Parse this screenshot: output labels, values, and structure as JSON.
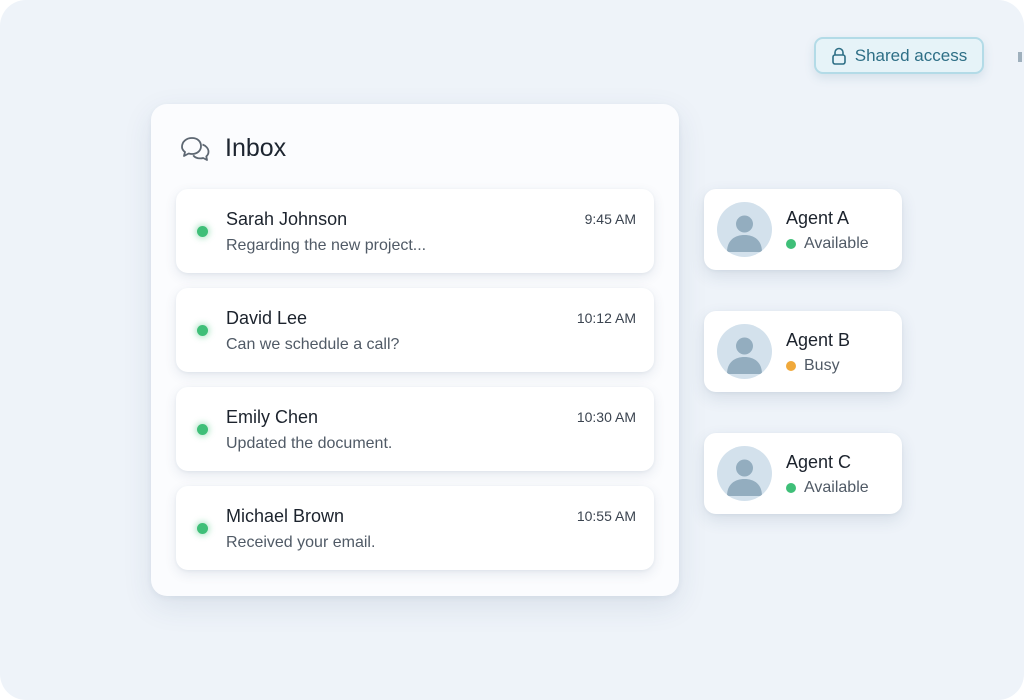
{
  "shared_access": {
    "label": "Shared access",
    "icon": "lock-icon"
  },
  "inbox": {
    "title": "Inbox",
    "icon": "chat-bubbles-icon",
    "messages": [
      {
        "sender": "Sarah Johnson",
        "preview": "Regarding the new project...",
        "time": "9:45 AM"
      },
      {
        "sender": "David Lee",
        "preview": "Can we schedule a call?",
        "time": "10:12 AM"
      },
      {
        "sender": "Emily Chen",
        "preview": "Updated the document.",
        "time": "10:30 AM"
      },
      {
        "sender": "Michael Brown",
        "preview": "Received your email.",
        "time": "10:55 AM"
      }
    ]
  },
  "agents": [
    {
      "name": "Agent A",
      "status": "Available",
      "status_color": "#3fbf78"
    },
    {
      "name": "Agent B",
      "status": "Busy",
      "status_color": "#f0a93b"
    },
    {
      "name": "Agent C",
      "status": "Available",
      "status_color": "#3fbf78"
    }
  ],
  "colors": {
    "background": "#eef3f9",
    "accent": "#2e6f86",
    "available": "#3fbf78",
    "busy": "#f0a93b"
  }
}
